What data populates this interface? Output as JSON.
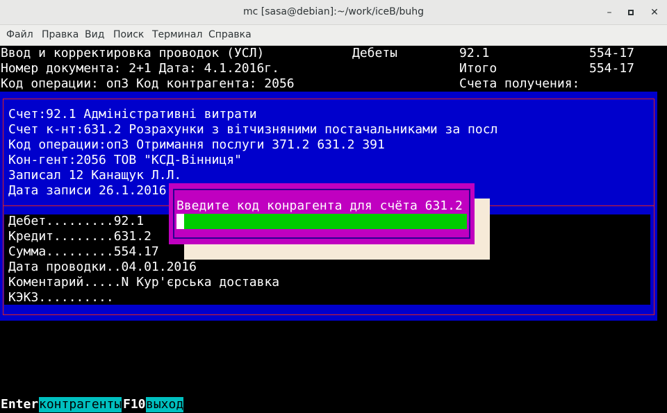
{
  "window": {
    "title": "mc [sasa@debian]:~/work/iceB/buhg",
    "minimize_glyph": "–",
    "close_glyph": "✕"
  },
  "menu": {
    "items": [
      "Файл",
      "Правка",
      "Вид",
      "Поиск",
      "Терминал",
      "Справка"
    ]
  },
  "header": {
    "line1": "Ввод и корректировка проводок (УСЛ)",
    "line2": "Номер документа: 2+1 Дата: 4.1.2016г.",
    "line3": "Код операции: оп3 Код контрагента: 2056",
    "debits_label": "Дебеты",
    "debit_account": "92.1",
    "debit_amount": "554-17",
    "total_label": "Итого",
    "total_amount": "554-17",
    "receipt_accounts_label": "Счета получения:"
  },
  "details": {
    "account": "Счет:92.1 Адміністративні витрати",
    "corr_account": "Счет к-нт:631.2 Розрахунки з вітчизняними постачальниками за посл",
    "operation": "Код операции:оп3 Отримання послуги 371.2 631.2 391",
    "counterparty": "Кон-гент:2056 ТОВ \"КСД-Вінниця\"",
    "recorded_by": "Записал 12 Канащук Л.Л.",
    "record_date": "Дата записи 26.1.2016"
  },
  "entry": {
    "debit": "Дебет.........92.1",
    "credit": "Кредит........631.2",
    "sum": "Сумма.........554.17",
    "posting_date": "Дата проводки..04.01.2016",
    "comment": "Коментарий.....N Кур'єрська доставка",
    "kekz": "КЭКЗ.........."
  },
  "dialog": {
    "prompt": "Введите код конрагента для счёта 631.2",
    "input_value": ""
  },
  "keybar": {
    "enter_key": "Enter",
    "enter_label": "контрагенты",
    "f10_key": "F10",
    "f10_label": "выход"
  },
  "colors": {
    "panel_blue": "#0000cc",
    "border_red": "#e02020",
    "dialog_magenta": "#c000c0",
    "input_green": "#00cc00",
    "key_label_cyan": "#00c0c0"
  }
}
